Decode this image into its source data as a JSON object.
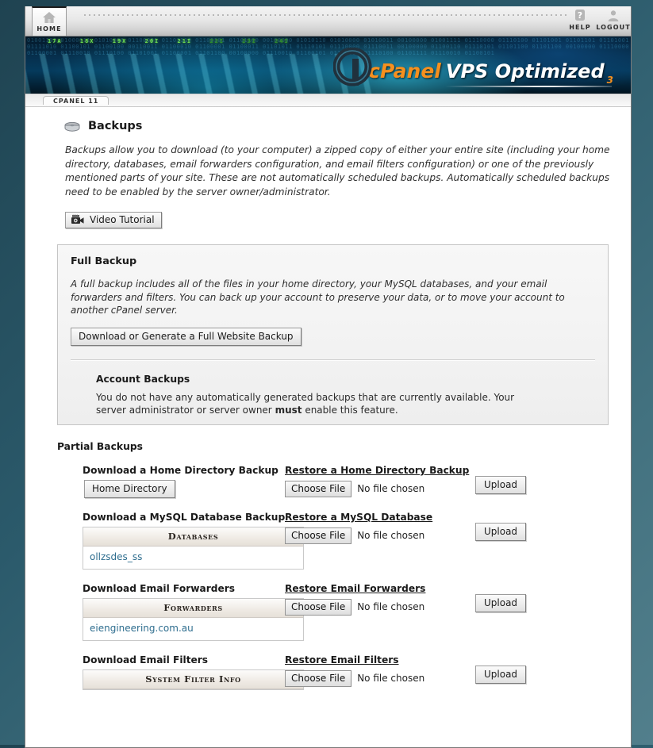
{
  "topbar": {
    "home": {
      "label": "HOME",
      "icon": "home-icon"
    },
    "help": {
      "label": "HELP",
      "icon": "question-mark-icon"
    },
    "logout": {
      "label": "LOGOUT",
      "icon": "user-icon"
    }
  },
  "banner": {
    "brand_name": "cPanel",
    "brand_product": "VPS Optimized",
    "brand_version": "3",
    "ticks": [
      "17A",
      "18X",
      "19X",
      "20I",
      "21I",
      "22I",
      "23I",
      "24I"
    ],
    "code_texts": "01001101 01000011 01010000 01100001 01101110 01100101 01101100 00100000 01010110 01010000 01010011 00100000 01001111 01110000 01110100 01101001 01101101 01101001 01111010 01100101 01100100 00110011 01100010 01100001 01100011 01101011 01110101 01110000 01110011 00100000 01100110 01110101 01101100 01101100 00100000 01110000 01100001 01110010 01110100 01101001 01100001 01101100 00100000 01110010 01100101 01110011 01110100 01101111 01110010 01100101",
    "accent_orange": "#f6901e",
    "deep_blue": "#042a44"
  },
  "tab": {
    "label": "CPANEL 11"
  },
  "page": {
    "title": "Backups",
    "title_icon": "disk-drive-icon",
    "intro": "Backups allow you to download (to your computer) a zipped copy of either your entire site (including your home directory, databases, email forwarders configuration, and email filters configuration) or one of the previously mentioned parts of your site. These are not automatically scheduled backups. Automatically scheduled backups need to be enabled by the server owner/administrator.",
    "video_tutorial_label": "Video Tutorial",
    "video_tutorial_icon": "movie-camera-icon"
  },
  "full_backup": {
    "heading": "Full Backup",
    "description": "A full backup includes all of the files in your home directory, your MySQL databases, and your email forwarders and filters. You can back up your account to preserve your data, or to move your account to another cPanel server.",
    "button_label": "Download or Generate a Full Website Backup",
    "account_backups": {
      "heading": "Account Backups",
      "text_before": "You do not have any automatically generated backups that are currently available. Your server administrator or server owner ",
      "emphasis": "must",
      "text_after": " enable this feature."
    }
  },
  "partial_backups": {
    "heading": "Partial Backups",
    "rows": [
      {
        "download_label": "Download a Home Directory Backup",
        "download_button": "Home Directory",
        "widget": "button",
        "restore_label": "Restore a Home Directory Backup",
        "choose_file_label": "Choose File",
        "file_status": "No file chosen",
        "upload_label": "Upload"
      },
      {
        "download_label": "Download a MySQL Database Backup",
        "widget": "table",
        "table_header": "Databases",
        "table_rows": [
          "ollzsdes_ss"
        ],
        "restore_label": "Restore a MySQL Database",
        "choose_file_label": "Choose File",
        "file_status": "No file chosen",
        "upload_label": "Upload"
      },
      {
        "download_label": "Download Email Forwarders",
        "widget": "table",
        "table_header": "Forwarders",
        "table_rows": [
          "eiengineering.com.au"
        ],
        "restore_label": "Restore Email Forwarders",
        "choose_file_label": "Choose File",
        "file_status": "No file chosen",
        "upload_label": "Upload"
      },
      {
        "download_label": "Download Email Filters",
        "widget": "table-header-only",
        "table_header": "System Filter Info",
        "table_rows": [],
        "restore_label": "Restore Email Filters",
        "choose_file_label": "Choose File",
        "file_status": "No file chosen",
        "upload_label": "Upload"
      }
    ]
  },
  "colors": {
    "page_bg_outer": "#2b5a6b",
    "panel_bg": "#f2f2f2",
    "link_blue": "#2f6e8f",
    "text_dark": "#1a1a1a"
  }
}
